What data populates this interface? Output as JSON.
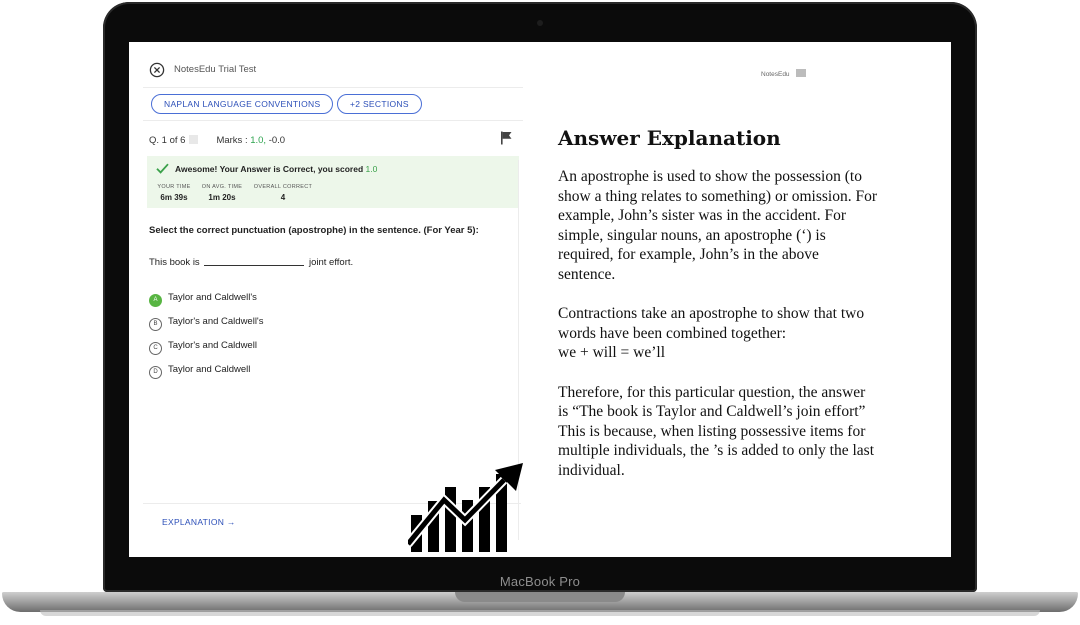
{
  "device": {
    "label": "MacBook Pro"
  },
  "app": {
    "title": "NotesEdu Trial Test",
    "brand": "NotesEdu"
  },
  "sections": {
    "primary": "NAPLAN LANGUAGE CONVENTIONS",
    "more": "+2 SECTIONS"
  },
  "question_meta": {
    "number_text": "Q. 1 of 6",
    "marks_label": "Marks :",
    "marks_positive": "1.0,",
    "marks_negative": "-0.0"
  },
  "result": {
    "message": "Awesome! Your Answer is Correct, you scored",
    "score": "1.0",
    "stats": [
      {
        "label": "YOUR TIME",
        "value": "6m 39s"
      },
      {
        "label": "ON AVG. TIME",
        "value": "1m 20s"
      },
      {
        "label": "OVERALL CORRECT",
        "value": "4"
      }
    ]
  },
  "question": {
    "prompt": "Select the correct punctuation (apostrophe) in the sentence. (For Year 5):",
    "sentence_before": "This book is",
    "sentence_after": "joint effort."
  },
  "options": [
    {
      "letter": "A",
      "text": "Taylor and Caldwell's",
      "correct": true
    },
    {
      "letter": "B",
      "text": "Taylor's and Caldwell's",
      "correct": false
    },
    {
      "letter": "C",
      "text": "Taylor's and Caldwell",
      "correct": false
    },
    {
      "letter": "D",
      "text": "Taylor and Caldwell",
      "correct": false
    }
  ],
  "footer": {
    "explanation_label": "EXPLANATION"
  },
  "explanation": {
    "title": "Answer Explanation",
    "p1": "An apostrophe is used to show the possession (to show a thing relates to something) or omission. For example, John’s sister was in the accident. For simple, singular nouns, an apostrophe (‘) is required, for example, John’s in the above sentence.",
    "p2a": "Contractions take an apostrophe to show that two words have been combined together:",
    "p2b": "we + will = we’ll",
    "p3a": "Therefore, for this particular question, the answer is “The book is Taylor and Caldwell’s join effort”",
    "p3b": "This is because, when listing possessive items for multiple individuals, the ’s is added to only the last individual."
  },
  "colors": {
    "accent": "#2c4fb8",
    "success": "#58b543",
    "result_bg": "#edf7ea"
  },
  "icons": [
    "close-icon",
    "flag-icon",
    "check-icon",
    "arrow-right-icon",
    "growth-chart-icon",
    "book-icon",
    "camera"
  ]
}
